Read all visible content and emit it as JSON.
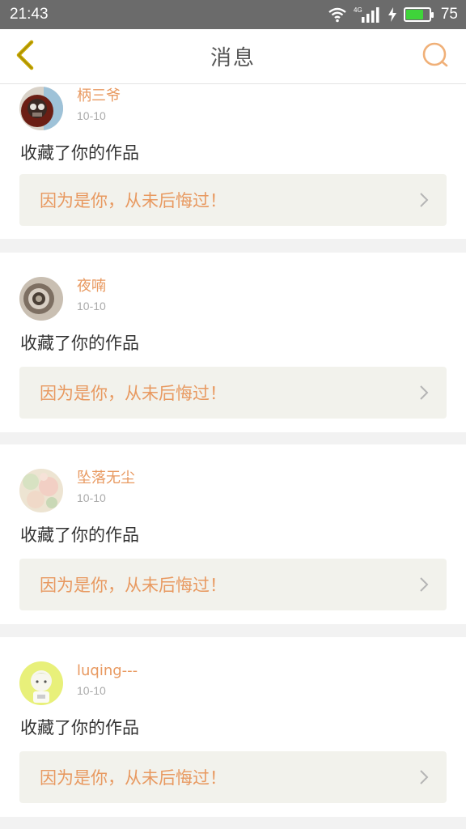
{
  "status_bar": {
    "time": "21:43",
    "network": "4G",
    "battery_level": "75",
    "battery_fraction": 0.75,
    "icons": [
      "wifi-icon",
      "signal-icon",
      "charging-icon",
      "battery-icon"
    ]
  },
  "header": {
    "title": "消息",
    "back_icon": "chevron-left-icon",
    "search_icon": "search-icon"
  },
  "colors": {
    "accent": "#e89960",
    "back_arrow": "#c8a800",
    "quote_bg": "#f2f2ec",
    "status_bar_bg": "#6b6b6b"
  },
  "messages": [
    {
      "username": "柄三爷",
      "date": "10-10",
      "action": "收藏了你的作品",
      "work_title": "因为是你，从未后悔过！"
    },
    {
      "username": "夜喃",
      "date": "10-10",
      "action": "收藏了你的作品",
      "work_title": "因为是你，从未后悔过！"
    },
    {
      "username": "坠落无尘",
      "date": "10-10",
      "action": "收藏了你的作品",
      "work_title": "因为是你，从未后悔过！"
    },
    {
      "username": "luqing---",
      "date": "10-10",
      "action": "收藏了你的作品",
      "work_title": "因为是你，从未后悔过！"
    }
  ]
}
